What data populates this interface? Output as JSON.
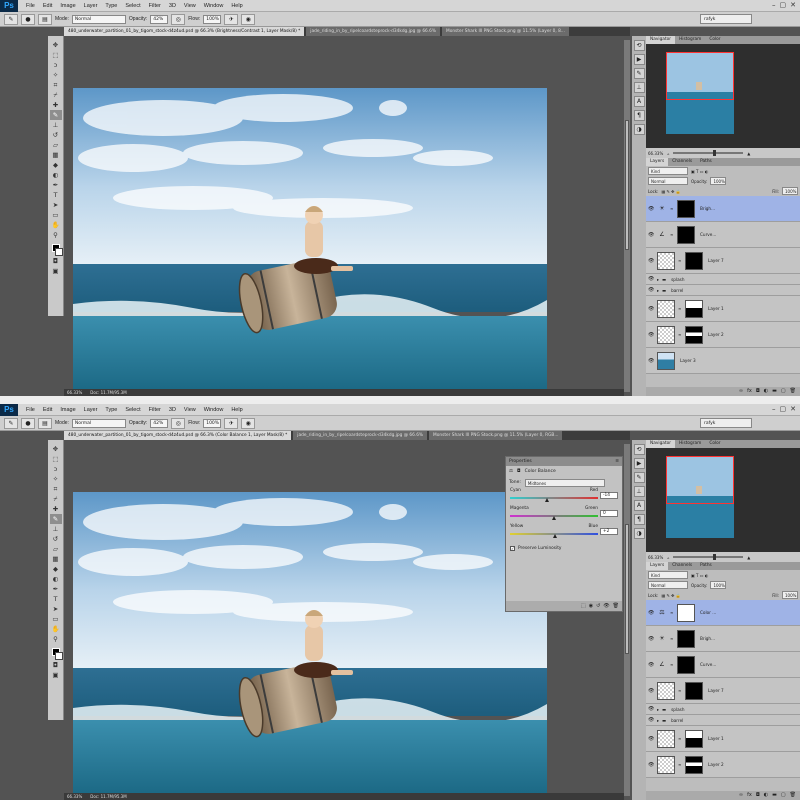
{
  "top": {
    "menu": [
      "File",
      "Edit",
      "Image",
      "Layer",
      "Type",
      "Select",
      "Filter",
      "3D",
      "View",
      "Window",
      "Help"
    ],
    "options": {
      "mode_label": "Mode:",
      "mode_value": "Normal",
      "opacity_label": "Opacity:",
      "opacity_value": "42%",
      "flow_label": "Flow:",
      "flow_value": "100%"
    },
    "workspace": "rafyk",
    "tabs": [
      "480_underwater_partition_01_by_tigom_stock-d4z4ud.psd @ 66.3% (Brightness/Contrast 1, Layer Mask/8) *",
      "jade_riding_in_by_ripelcoardsteprock-d34kdg.jpg @ 66.6%",
      "Monster Shark III PNG Stock.png @ 11.5% (Layer 0, 8..."
    ],
    "status": {
      "zoom": "66.33%",
      "doc": "Doc: 11.7M/95.3M"
    },
    "panel": {
      "tabs_top": [
        "Navigator",
        "Histogram",
        "Color"
      ],
      "zoom": "66.33%",
      "tabs_layers": [
        "Layers",
        "Channels",
        "Paths"
      ],
      "kind": "Kind",
      "blend": "Normal",
      "opacity_label": "Opacity:",
      "opacity_value": "100%",
      "lock_label": "Lock:",
      "fill_label": "Fill:",
      "fill_value": "100%",
      "layers": [
        {
          "name": "Brigh...",
          "type": "adj",
          "icon": "☀",
          "mask": "black",
          "sel": true
        },
        {
          "name": "Curve...",
          "type": "adj",
          "icon": "∠",
          "mask": "black",
          "sel": false
        },
        {
          "name": "Layer 7",
          "type": "layer",
          "mask": "black",
          "sel": false
        },
        {
          "name": "splash",
          "type": "group"
        },
        {
          "name": "barrel",
          "type": "group"
        },
        {
          "name": "Layer 1",
          "type": "layer",
          "mask": "bw",
          "sel": false
        },
        {
          "name": "Layer 2",
          "type": "layer",
          "mask": "wb",
          "sel": false
        },
        {
          "name": "Layer 3",
          "type": "sea",
          "sel": false
        }
      ]
    }
  },
  "bottom": {
    "menu": [
      "File",
      "Edit",
      "Image",
      "Layer",
      "Type",
      "Select",
      "Filter",
      "3D",
      "View",
      "Window",
      "Help"
    ],
    "options": {
      "mode_label": "Mode:",
      "mode_value": "Normal",
      "opacity_label": "Opacity:",
      "opacity_value": "42%",
      "flow_label": "Flow:",
      "flow_value": "100%"
    },
    "workspace": "rafyk",
    "tabs": [
      "480_underwater_partition_01_by_tigom_stock-d4z4ud.psd @ 66.3% (Color Balance 1, Layer Mask/8) *",
      "jade_riding_in_by_ripelcoardsteprock-d34kdg.jpg @ 66.6%",
      "Monster Shark III PNG Stock.png @ 11.5% (Layer 0, RGB..."
    ],
    "status": {
      "zoom": "66.33%",
      "doc": "Doc: 11.7M/95.3M"
    },
    "properties": {
      "tab": "Properties",
      "title": "Color Balance",
      "tone_label": "Tone:",
      "tone_value": "Midtones",
      "sliders": [
        {
          "left": "Cyan",
          "right": "Red",
          "value": "-14",
          "pos": 0.42,
          "colors": [
            "#2fd0d0",
            "#e03030"
          ]
        },
        {
          "left": "Magenta",
          "right": "Green",
          "value": "0",
          "pos": 0.5,
          "colors": [
            "#d030d0",
            "#30c030"
          ]
        },
        {
          "left": "Yellow",
          "right": "Blue",
          "value": "+2",
          "pos": 0.51,
          "colors": [
            "#e0d030",
            "#3050e0"
          ]
        }
      ],
      "preserve": "Preserve Luminosity"
    },
    "panel": {
      "tabs_top": [
        "Navigator",
        "Histogram",
        "Color"
      ],
      "zoom": "66.33%",
      "tabs_layers": [
        "Layers",
        "Channels",
        "Paths"
      ],
      "kind": "Kind",
      "blend": "Normal",
      "opacity_label": "Opacity:",
      "opacity_value": "100%",
      "lock_label": "Lock:",
      "fill_label": "Fill:",
      "fill_value": "100%",
      "layers": [
        {
          "name": "Color ...",
          "type": "adj",
          "icon": "⚖",
          "mask": "white",
          "sel": true
        },
        {
          "name": "Brigh...",
          "type": "adj",
          "icon": "☀",
          "mask": "black",
          "sel": false
        },
        {
          "name": "Curve...",
          "type": "adj",
          "icon": "∠",
          "mask": "black",
          "sel": false
        },
        {
          "name": "Layer 7",
          "type": "layer",
          "mask": "black",
          "sel": false
        },
        {
          "name": "splash",
          "type": "group"
        },
        {
          "name": "barrel",
          "type": "group"
        },
        {
          "name": "Layer 1",
          "type": "layer",
          "mask": "bw",
          "sel": false
        },
        {
          "name": "Layer 2",
          "type": "layer",
          "mask": "wb",
          "sel": false
        }
      ]
    }
  },
  "icons": {
    "eye": "eye-icon",
    "folder": "folder-icon",
    "link": "chain-link-icon",
    "brush": "brush-icon",
    "trash": "trash-icon",
    "new": "new-layer-icon"
  }
}
